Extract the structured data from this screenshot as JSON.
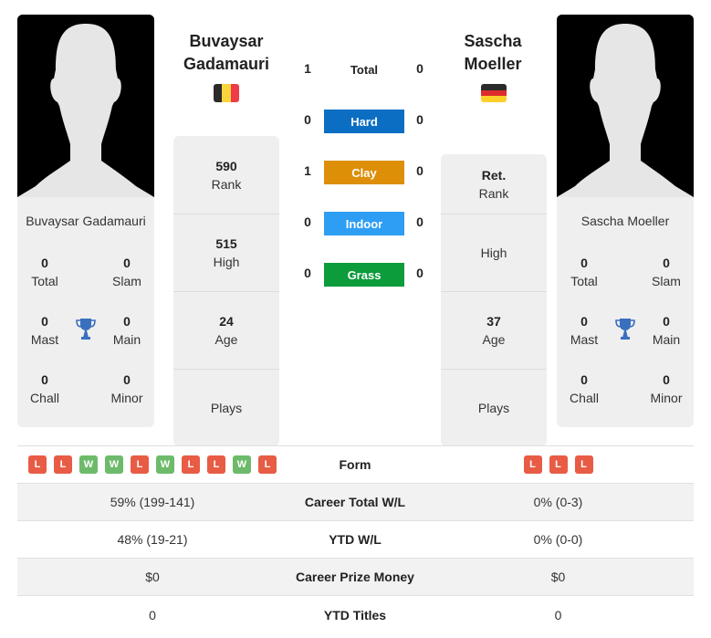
{
  "player1": {
    "name_line1": "Buvaysar",
    "name_line2": "Gadamauri",
    "full_name": "Buvaysar Gadamauri",
    "flag": {
      "country": "Belgium",
      "colors": [
        "#2b2b2b",
        "#f9d43c",
        "#ef3a47"
      ]
    },
    "titles": {
      "total": {
        "value": "0",
        "label": "Total"
      },
      "slam": {
        "value": "0",
        "label": "Slam"
      },
      "mast": {
        "value": "0",
        "label": "Mast"
      },
      "main": {
        "value": "0",
        "label": "Main"
      },
      "chall": {
        "value": "0",
        "label": "Chall"
      },
      "minor": {
        "value": "0",
        "label": "Minor"
      }
    },
    "info": [
      {
        "value": "590",
        "label": "Rank"
      },
      {
        "value": "515",
        "label": "High"
      },
      {
        "value": "24",
        "label": "Age"
      },
      {
        "value": "",
        "label": "Plays"
      }
    ]
  },
  "player2": {
    "name_line1": "Sascha",
    "name_line2": "Moeller",
    "full_name": "Sascha Moeller",
    "flag": {
      "country": "Germany",
      "colors": [
        "#2b2b2b",
        "#dd2c2c",
        "#fdcf2a"
      ]
    },
    "titles": {
      "total": {
        "value": "0",
        "label": "Total"
      },
      "slam": {
        "value": "0",
        "label": "Slam"
      },
      "mast": {
        "value": "0",
        "label": "Mast"
      },
      "main": {
        "value": "0",
        "label": "Main"
      },
      "chall": {
        "value": "0",
        "label": "Chall"
      },
      "minor": {
        "value": "0",
        "label": "Minor"
      }
    },
    "info": [
      {
        "value": "Ret.",
        "label": "Rank"
      },
      {
        "value": "",
        "label": "High"
      },
      {
        "value": "37",
        "label": "Age"
      },
      {
        "value": "",
        "label": "Plays"
      }
    ]
  },
  "h2h": [
    {
      "label": "Total",
      "p1": "1",
      "p2": "0",
      "color": null
    },
    {
      "label": "Hard",
      "p1": "0",
      "p2": "0",
      "color": "#0b6ec2"
    },
    {
      "label": "Clay",
      "p1": "1",
      "p2": "0",
      "color": "#dc8f07"
    },
    {
      "label": "Indoor",
      "p1": "0",
      "p2": "0",
      "color": "#2e9ef4"
    },
    {
      "label": "Grass",
      "p1": "0",
      "p2": "0",
      "color": "#0c9c3c"
    }
  ],
  "table": {
    "form": {
      "label": "Form",
      "p1": [
        "L",
        "L",
        "W",
        "W",
        "L",
        "W",
        "L",
        "L",
        "W",
        "L"
      ],
      "p2": [
        "L",
        "L",
        "L"
      ]
    },
    "rows": [
      {
        "label": "Career Total W/L",
        "p1": "59% (199-141)",
        "p2": "0% (0-3)"
      },
      {
        "label": "YTD W/L",
        "p1": "48% (19-21)",
        "p2": "0% (0-0)"
      },
      {
        "label": "Career Prize Money",
        "p1": "$0",
        "p2": "$0"
      },
      {
        "label": "YTD Titles",
        "p1": "0",
        "p2": "0"
      }
    ]
  },
  "icons": {
    "trophy": "trophy-icon",
    "silhouette": "player-silhouette"
  },
  "colors": {
    "trophy": "#3a6fbf",
    "loss": "#e85c45",
    "win": "#6dbb6a"
  }
}
